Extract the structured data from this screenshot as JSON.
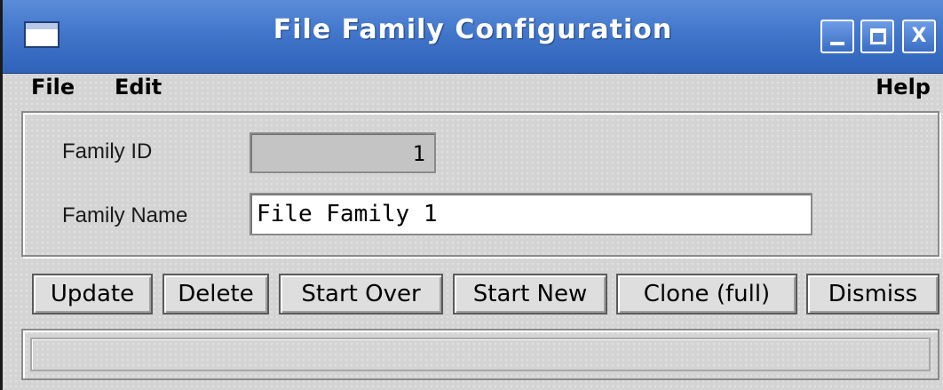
{
  "window": {
    "title": "File Family Configuration",
    "controls": {
      "minimize": "_",
      "maximize": "",
      "close": "X"
    }
  },
  "menu": {
    "file": "File",
    "edit": "Edit",
    "help": "Help"
  },
  "form": {
    "family_id_label": "Family ID",
    "family_id_value": "1",
    "family_name_label": "Family Name",
    "family_name_value": "File Family 1"
  },
  "buttons": {
    "update": "Update",
    "delete": "Delete",
    "start_over": "Start Over",
    "start_new": "Start New",
    "clone_full": "Clone (full)",
    "dismiss": "Dismiss"
  },
  "status": {
    "text": ""
  },
  "colors": {
    "titlebar": "#3f74c9",
    "window_bg": "#d4d4d4",
    "readonly_field": "#c4c4c4"
  },
  "icons": {
    "window_menu": "window-icon",
    "minimize": "minimize-icon",
    "maximize": "maximize-icon",
    "close": "close-icon"
  }
}
